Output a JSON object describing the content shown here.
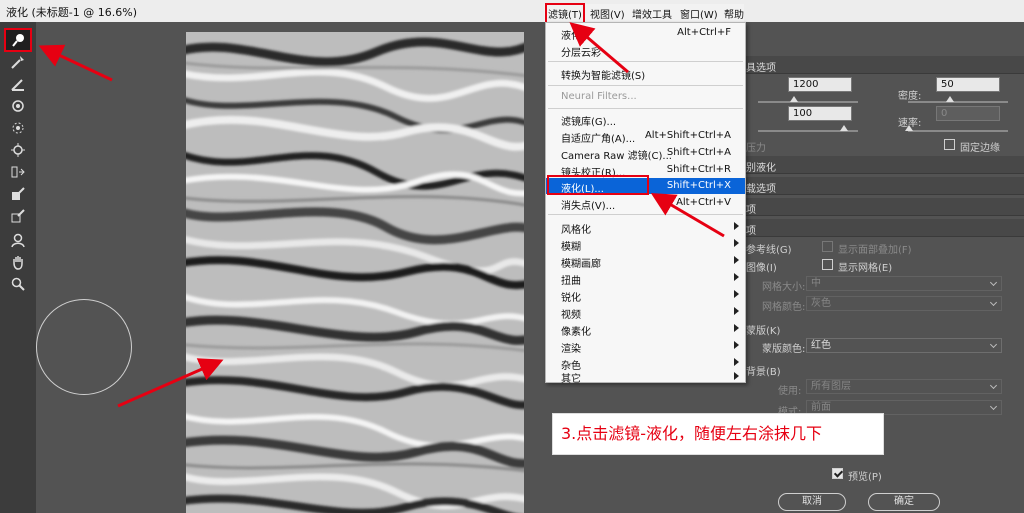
{
  "window": {
    "title": "液化 (未标题-1 @ 16.6%)"
  },
  "menubar": {
    "items": [
      "滤镜(T)",
      "视图(V)",
      "增效工具",
      "窗口(W)",
      "帮助"
    ]
  },
  "filter_menu": {
    "items": [
      {
        "label": "液化",
        "shortcut": "Alt+Ctrl+F"
      },
      {
        "label": "分层云彩",
        "shortcut": ""
      },
      {
        "label": "转换为智能滤镜(S)",
        "shortcut": ""
      },
      {
        "label": "Neural Filters...",
        "shortcut": ""
      },
      {
        "label": "滤镜库(G)...",
        "shortcut": ""
      },
      {
        "label": "自适应广角(A)...",
        "shortcut": "Alt+Shift+Ctrl+A"
      },
      {
        "label": "Camera Raw 滤镜(C)...",
        "shortcut": "Shift+Ctrl+A"
      },
      {
        "label": "镜头校正(R)...",
        "shortcut": "Shift+Ctrl+R"
      },
      {
        "label": "液化(L)...",
        "shortcut": "Shift+Ctrl+X"
      },
      {
        "label": "消失点(V)...",
        "shortcut": "Alt+Ctrl+V"
      },
      {
        "label": "风格化",
        "shortcut": ""
      },
      {
        "label": "模糊",
        "shortcut": ""
      },
      {
        "label": "模糊画廊",
        "shortcut": ""
      },
      {
        "label": "扭曲",
        "shortcut": ""
      },
      {
        "label": "锐化",
        "shortcut": ""
      },
      {
        "label": "视频",
        "shortcut": ""
      },
      {
        "label": "像素化",
        "shortcut": ""
      },
      {
        "label": "渲染",
        "shortcut": ""
      },
      {
        "label": "杂色",
        "shortcut": ""
      },
      {
        "label": "其它",
        "shortcut": ""
      }
    ]
  },
  "panel": {
    "brush_header": "具选项",
    "size_value": "1200",
    "density_label": "密度:",
    "density_value": "50",
    "pressure_value": "100",
    "rate_label": "速率:",
    "rate_value": "0",
    "pressure_text": "压力",
    "pin_edges_label": "固定边缘",
    "face_aware_header": "别液化",
    "load_mesh_header": "载选项",
    "mask_options_header": "项",
    "view_options_header": "项",
    "show_guides_label": "参考线(G)",
    "show_face_overlay_label": "显示面部叠加(F)",
    "show_image_label": "图像(I)",
    "show_mesh_label": "显示网格(E)",
    "mesh_size_label": "网格大小:",
    "mesh_size_value": "中",
    "mesh_color_label": "网格颜色:",
    "mesh_color_value": "灰色",
    "show_mask_label": "蒙版(K)",
    "mask_color_label": "蒙版颜色:",
    "mask_color_value": "红色",
    "show_backdrop_label": "背景(B)",
    "use_label": "使用:",
    "use_value": "所有图层",
    "mode_label": "模式:",
    "mode_value": "前面",
    "preview_label": "预览(P)",
    "cancel_label": "取消",
    "ok_label": "确定"
  },
  "annotation": {
    "text": "3.点击滤镜-液化，随便左右涂抹几下"
  },
  "colors": {
    "accent_red": "#e60012",
    "highlight_blue": "#0a64d8"
  }
}
